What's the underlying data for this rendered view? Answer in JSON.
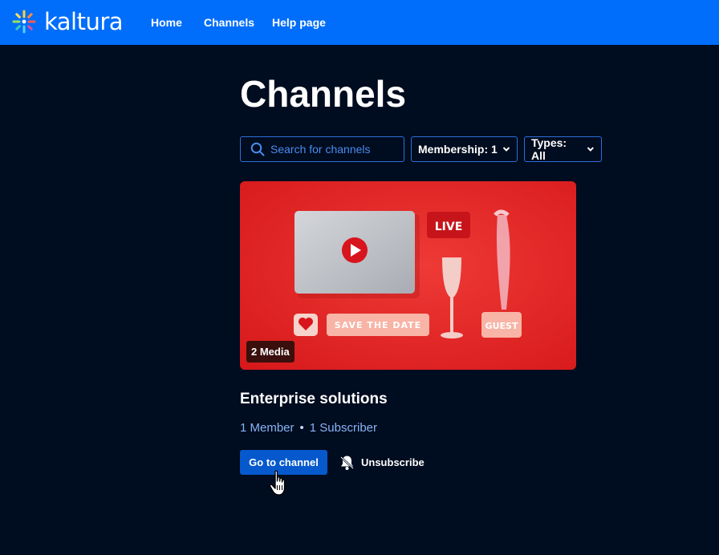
{
  "header": {
    "logo_text": "kaltura",
    "nav": [
      {
        "label": "Home"
      },
      {
        "label": "Channels"
      },
      {
        "label": "Help page"
      }
    ]
  },
  "page": {
    "title": "Channels"
  },
  "filters": {
    "search_placeholder": "Search for channels",
    "membership_label": "Membership: 1",
    "types_label": "Types: All"
  },
  "channel": {
    "badge": "2 Media",
    "image_texts": {
      "live": "LIVE",
      "save_the_date": "SAVE THE DATE",
      "guest": "GUEST"
    },
    "title": "Enterprise solutions",
    "members": "1 Member",
    "separator": "•",
    "subscribers": "1 Subscriber",
    "go_label": "Go to channel",
    "unsubscribe_label": "Unsubscribe"
  },
  "colors": {
    "header_bg": "#006efa",
    "page_bg": "#000c1f",
    "primary_button": "#0659cc",
    "border": "#2d6edb",
    "meta_text": "#88b4f5"
  },
  "icons": [
    "kaltura-logo-icon",
    "search-icon",
    "chevron-down-icon",
    "play-icon",
    "heart-icon",
    "bell-slash-icon",
    "hand-pointer-icon"
  ]
}
